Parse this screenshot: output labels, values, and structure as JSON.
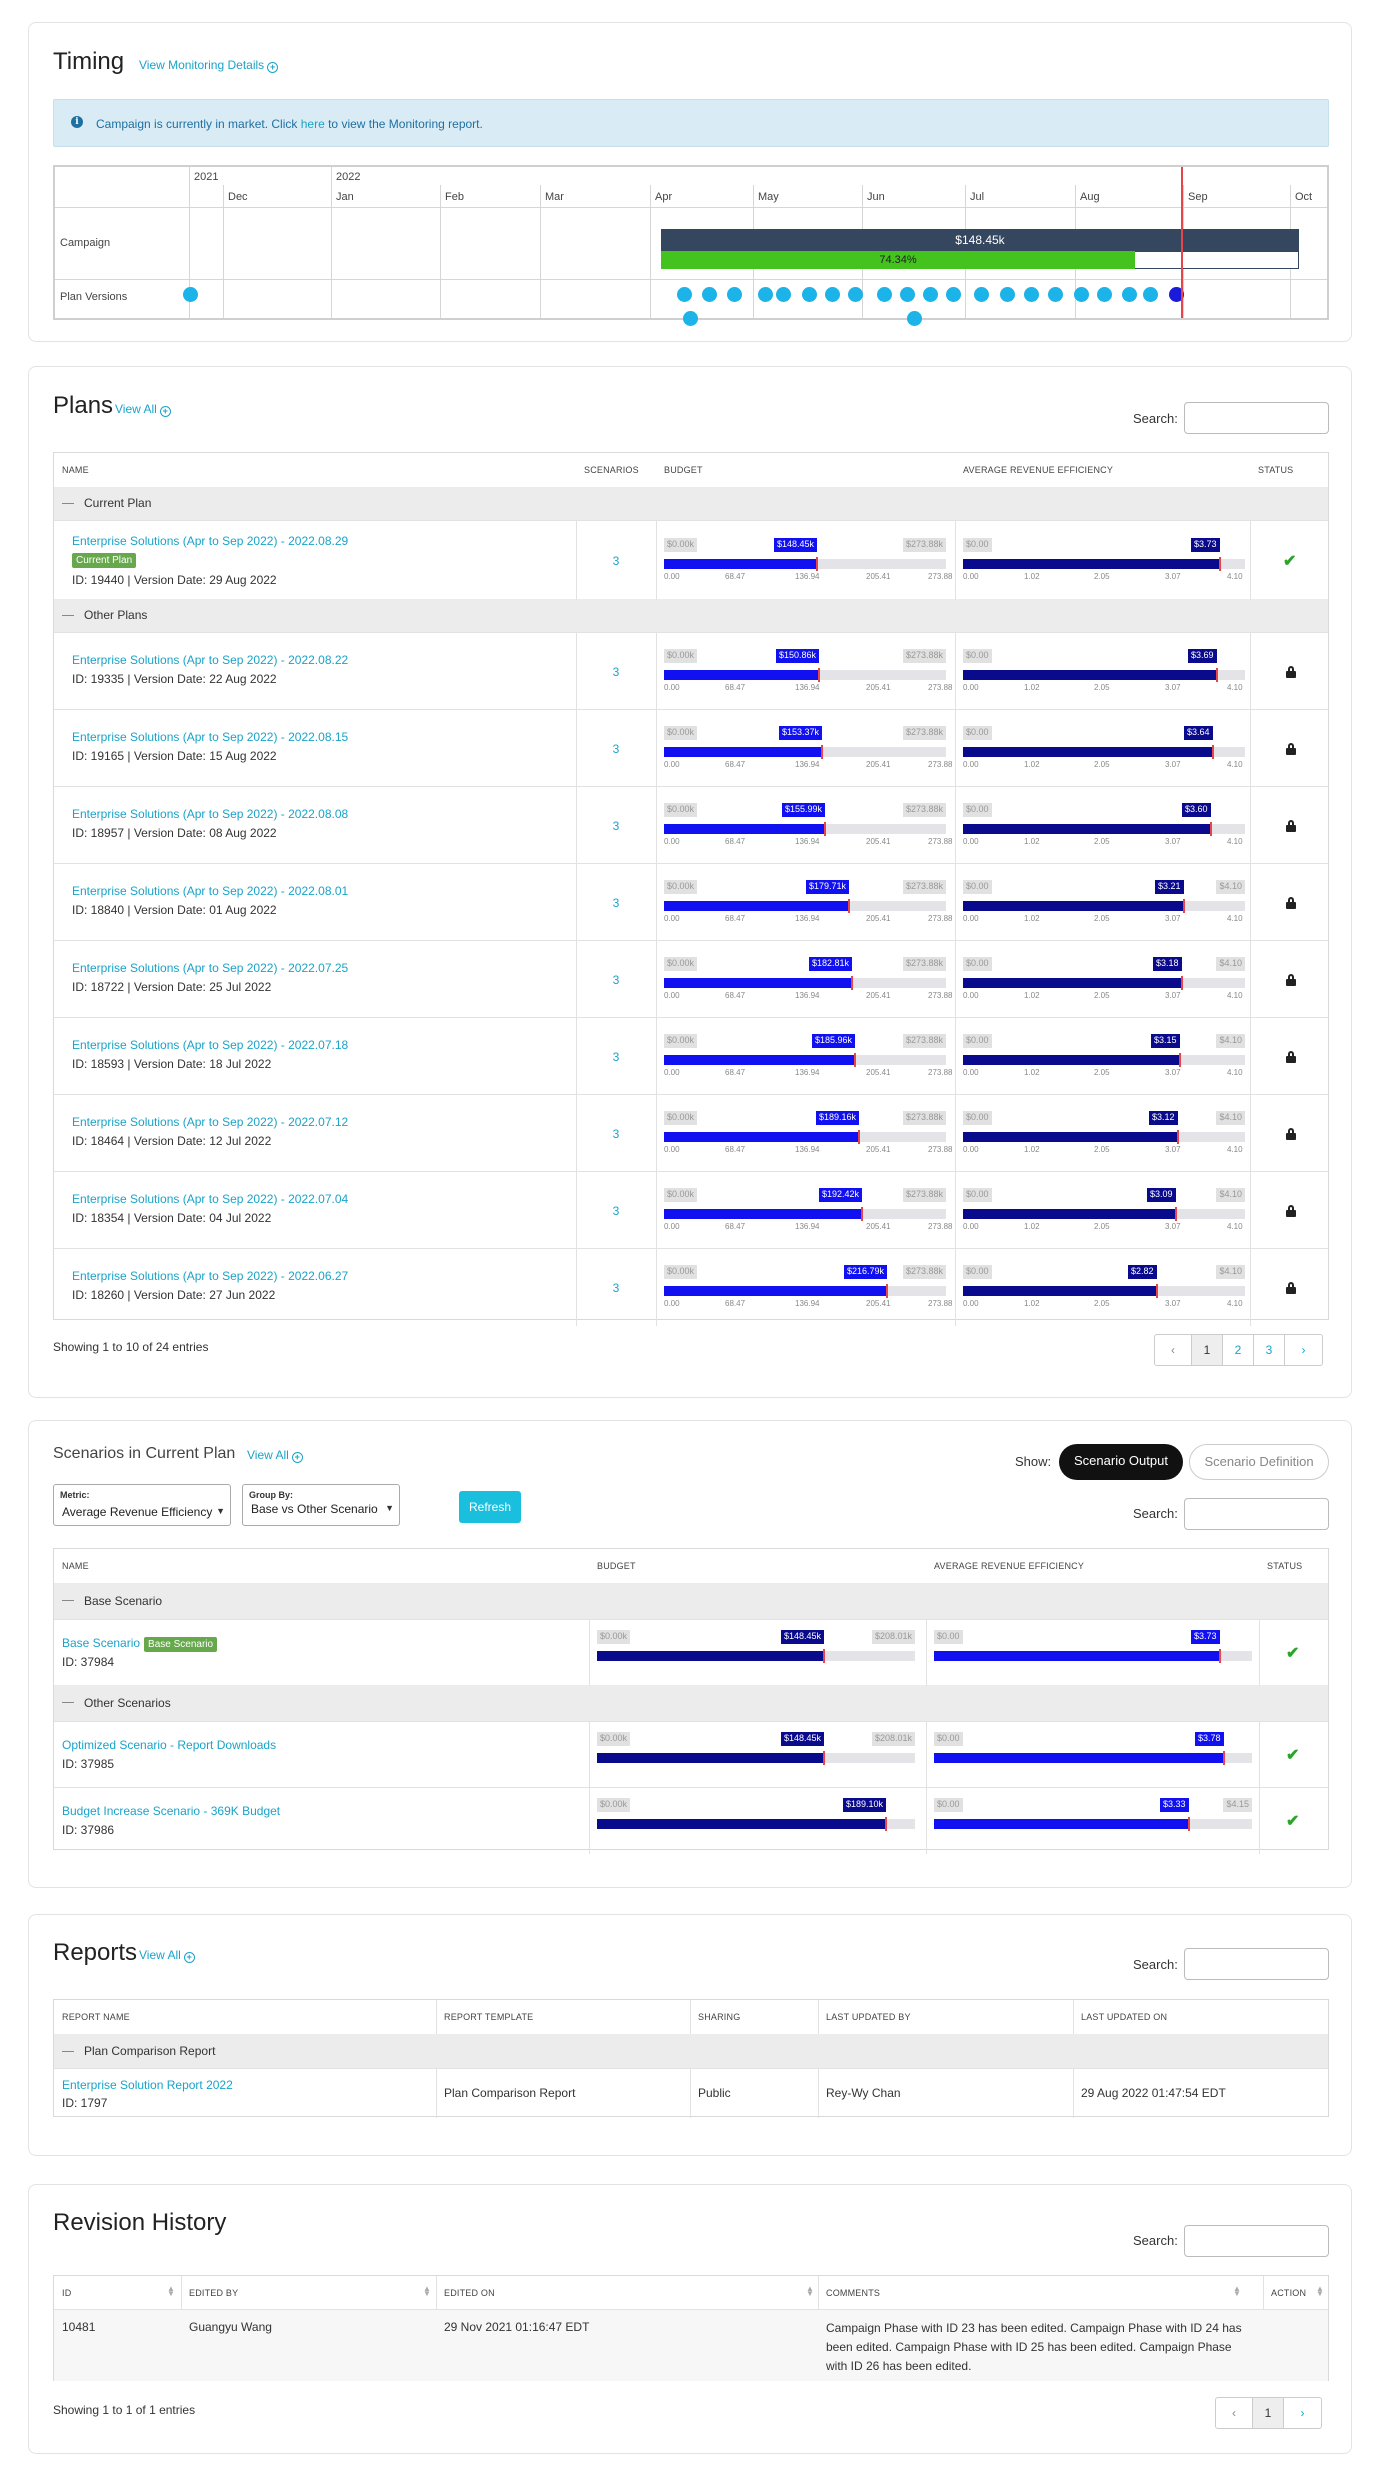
{
  "timing": {
    "title": "Timing",
    "monitoring_link": "View Monitoring Details",
    "info": {
      "before": "Campaign is currently in market. Click ",
      "link": "here",
      "after": " to view the Monitoring report."
    },
    "years": [
      "2021",
      "2022"
    ],
    "months": [
      "Dec",
      "Jan",
      "Feb",
      "Mar",
      "Apr",
      "May",
      "Jun",
      "Jul",
      "Aug",
      "Sep",
      "Oct"
    ],
    "rows": [
      "Campaign",
      "Plan Versions"
    ],
    "campaign_budget": "$148.45k",
    "campaign_progress": "74.34%",
    "campaign_progress_value": 0.7434
  },
  "plans": {
    "title": "Plans",
    "view_all": "View All",
    "search_label": "Search:",
    "columns": [
      "Name",
      "Scenarios",
      "Budget",
      "Average Revenue Efficiency",
      "Status"
    ],
    "group_current": "Current Plan",
    "group_other": "Other Plans",
    "current_badge": "Current Plan",
    "budget_ticks": [
      "0.00",
      "68.47",
      "136.94",
      "205.41",
      "273.88"
    ],
    "budget_min": "$0.00k",
    "budget_max": "$273.88k",
    "eff_ticks": [
      "0.00",
      "1.02",
      "2.05",
      "3.07",
      "4.10"
    ],
    "eff_min": "$0.00",
    "eff_max": "$4.10",
    "rows": [
      {
        "name": "Enterprise Solutions (Apr to Sep 2022) - 2022.08.29",
        "meta": "ID: 19440 | Version Date: 29 Aug 2022",
        "scenarios": "3",
        "budget": "$148.45k",
        "budget_val": 148.45,
        "eff": "$3.73",
        "eff_val": 3.73,
        "status": "check",
        "current": true
      },
      {
        "name": "Enterprise Solutions (Apr to Sep 2022) - 2022.08.22",
        "meta": "ID: 19335 | Version Date: 22 Aug 2022",
        "scenarios": "3",
        "budget": "$150.86k",
        "budget_val": 150.86,
        "eff": "$3.69",
        "eff_val": 3.69,
        "status": "lock"
      },
      {
        "name": "Enterprise Solutions (Apr to Sep 2022) - 2022.08.15",
        "meta": "ID: 19165 | Version Date: 15 Aug 2022",
        "scenarios": "3",
        "budget": "$153.37k",
        "budget_val": 153.37,
        "eff": "$3.64",
        "eff_val": 3.64,
        "status": "lock"
      },
      {
        "name": "Enterprise Solutions (Apr to Sep 2022) - 2022.08.08",
        "meta": "ID: 18957 | Version Date: 08 Aug 2022",
        "scenarios": "3",
        "budget": "$155.99k",
        "budget_val": 155.99,
        "eff": "$3.60",
        "eff_val": 3.6,
        "status": "lock"
      },
      {
        "name": "Enterprise Solutions (Apr to Sep 2022) - 2022.08.01",
        "meta": "ID: 18840 | Version Date: 01 Aug 2022",
        "scenarios": "3",
        "budget": "$179.71k",
        "budget_val": 179.71,
        "eff": "$3.21",
        "eff_val": 3.21,
        "status": "lock"
      },
      {
        "name": "Enterprise Solutions (Apr to Sep 2022) - 2022.07.25",
        "meta": "ID: 18722 | Version Date: 25 Jul 2022",
        "scenarios": "3",
        "budget": "$182.81k",
        "budget_val": 182.81,
        "eff": "$3.18",
        "eff_val": 3.18,
        "status": "lock"
      },
      {
        "name": "Enterprise Solutions (Apr to Sep 2022) - 2022.07.18",
        "meta": "ID: 18593 | Version Date: 18 Jul 2022",
        "scenarios": "3",
        "budget": "$185.96k",
        "budget_val": 185.96,
        "eff": "$3.15",
        "eff_val": 3.15,
        "status": "lock"
      },
      {
        "name": "Enterprise Solutions (Apr to Sep 2022) - 2022.07.12",
        "meta": "ID: 18464 | Version Date: 12 Jul 2022",
        "scenarios": "3",
        "budget": "$189.16k",
        "budget_val": 189.16,
        "eff": "$3.12",
        "eff_val": 3.12,
        "status": "lock"
      },
      {
        "name": "Enterprise Solutions (Apr to Sep 2022) - 2022.07.04",
        "meta": "ID: 18354 | Version Date: 04 Jul 2022",
        "scenarios": "3",
        "budget": "$192.42k",
        "budget_val": 192.42,
        "eff": "$3.09",
        "eff_val": 3.09,
        "status": "lock"
      },
      {
        "name": "Enterprise Solutions (Apr to Sep 2022) - 2022.06.27",
        "meta": "ID: 18260 | Version Date: 27 Jun 2022",
        "scenarios": "3",
        "budget": "$216.79k",
        "budget_val": 216.79,
        "eff": "$2.82",
        "eff_val": 2.82,
        "status": "lock"
      }
    ],
    "showing": "Showing 1 to 10 of 24 entries",
    "pages": [
      "‹",
      "1",
      "2",
      "3",
      "›"
    ]
  },
  "scenarios": {
    "title": "Scenarios in Current Plan",
    "view_all": "View All",
    "show_label": "Show:",
    "toggle_active": "Scenario Output",
    "toggle_inactive": "Scenario Definition",
    "metric_label": "Metric:",
    "metric_value": "Average Revenue Efficiency",
    "group_label": "Group By:",
    "group_value": "Base vs Other Scenario",
    "refresh": "Refresh",
    "search_label": "Search:",
    "columns": [
      "Name",
      "Budget",
      "Average Revenue Efficiency",
      "Status"
    ],
    "group_base": "Base Scenario",
    "group_other": "Other Scenarios",
    "base_badge": "Base Scenario",
    "budget_min": "$0.00k",
    "eff_min": "$0.00",
    "rows": [
      {
        "name": "Base Scenario",
        "meta": "ID: 37984",
        "budget": "$148.45k",
        "budget_val": 148.45,
        "budget_max": "$208.01k",
        "budget_max_val": 208.01,
        "eff": "$3.73",
        "eff_val": 3.73,
        "eff_max": "",
        "eff_max_val": 4.15,
        "base": true
      },
      {
        "name": "Optimized Scenario - Report Downloads",
        "meta": "ID: 37985",
        "budget": "$148.45k",
        "budget_val": 148.45,
        "budget_max": "$208.01k",
        "budget_max_val": 208.01,
        "eff": "$3.78",
        "eff_val": 3.78,
        "eff_max": "",
        "eff_max_val": 4.15
      },
      {
        "name": "Budget Increase Scenario - 369K Budget",
        "meta": "ID: 37986",
        "budget": "$189.10k",
        "budget_val": 189.1,
        "budget_max": "",
        "budget_max_val": 208.01,
        "eff": "$3.33",
        "eff_val": 3.33,
        "eff_max": "$4.15",
        "eff_max_val": 4.15
      }
    ]
  },
  "reports": {
    "title": "Reports",
    "view_all": "View All",
    "search_label": "Search:",
    "columns": [
      "Report Name",
      "Report Template",
      "Sharing",
      "Last Updated By",
      "Last Updated On"
    ],
    "group": "Plan Comparison Report",
    "row": {
      "name": "Enterprise Solution Report 2022",
      "meta": "ID: 1797",
      "template": "Plan Comparison Report",
      "sharing": "Public",
      "updated_by": "Rey-Wy Chan",
      "updated_on": "29 Aug 2022 01:47:54 EDT"
    }
  },
  "revisions": {
    "title": "Revision History",
    "search_label": "Search:",
    "columns": [
      "ID",
      "Edited By",
      "Edited On",
      "Comments",
      "Action"
    ],
    "row": {
      "id": "10481",
      "edited_by": "Guangyu Wang",
      "edited_on": "29 Nov 2021 01:16:47 EDT",
      "comments": "Campaign Phase with ID 23 has been edited. Campaign Phase with ID 24 has been edited. Campaign Phase with ID 25 has been edited. Campaign Phase with ID 26 has been edited."
    },
    "showing": "Showing 1 to 1 of 1 entries",
    "pages": [
      "‹",
      "1",
      "›"
    ]
  },
  "colors": {
    "accent": "#1aa3c8",
    "budget_fill": "#1010f0",
    "eff_fill": "#0a0a8c",
    "campaign_bar": "#34475f",
    "progress": "#44c21e",
    "marker": "#e8454a"
  }
}
